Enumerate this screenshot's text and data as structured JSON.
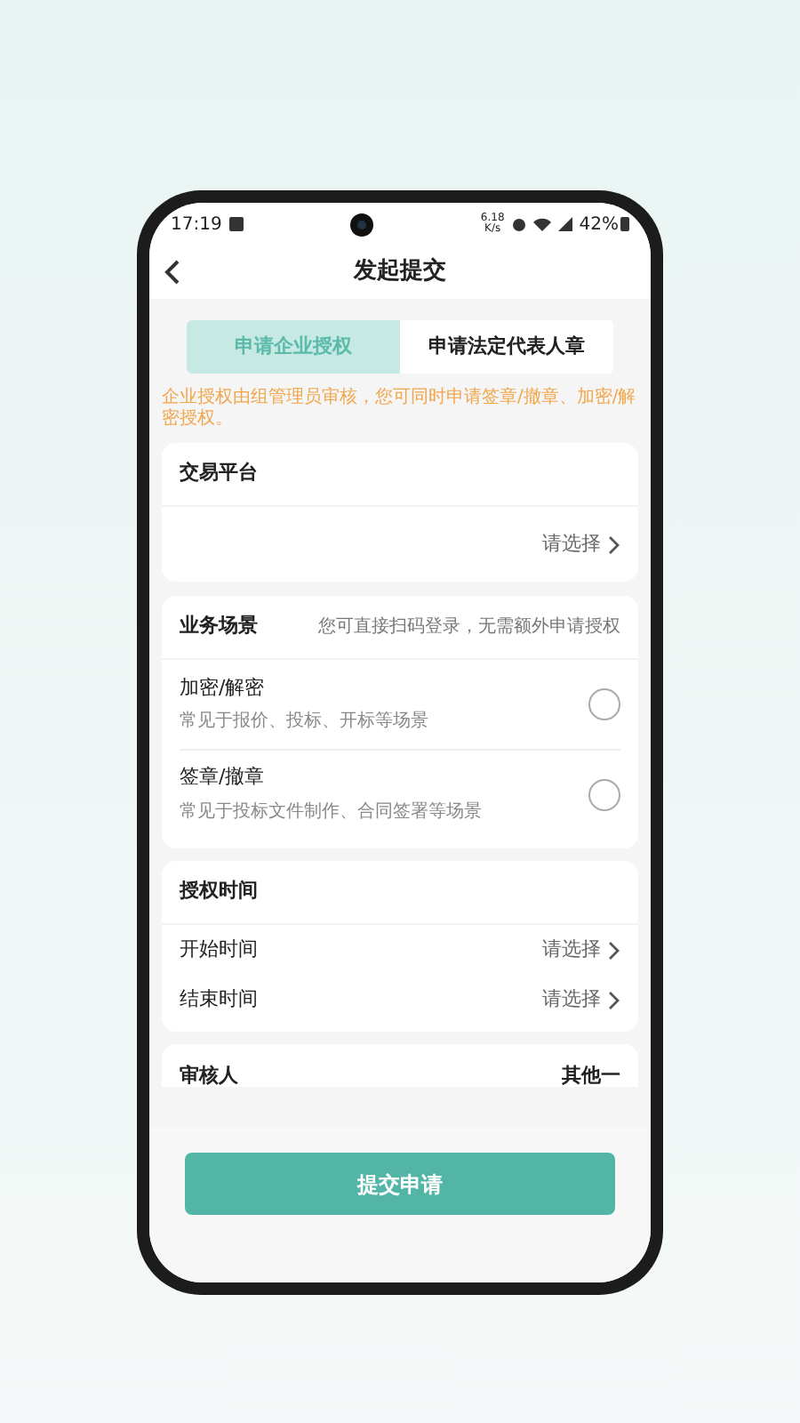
{
  "status_bar": {
    "time": "17:19",
    "speed": "6.18",
    "speed_unit": "K/s",
    "battery": "42%"
  },
  "header": {
    "title": "发起提交"
  },
  "tabs": [
    {
      "label": "申请企业授权",
      "selected": true
    },
    {
      "label": "申请法定代表人章",
      "selected": false
    }
  ],
  "notice": "企业授权由组管理员审核，您可同时申请签章/撤章、加密/解密授权。",
  "platform": {
    "title": "交易平台",
    "value": "请选择"
  },
  "scenario": {
    "title": "业务场景",
    "hint": "您可直接扫码登录，无需额外申请授权",
    "options": [
      {
        "label": "加密/解密",
        "description": "常见于报价、投标、开标等场景",
        "selected": false
      },
      {
        "label": "签章/撤章",
        "description": "常见于投标文件制作、合同签署等场景",
        "selected": false
      }
    ]
  },
  "period": {
    "title": "授权时间",
    "rows": [
      {
        "label": "开始时间",
        "value": "请选择"
      },
      {
        "label": "结束时间",
        "value": "请选择"
      }
    ]
  },
  "reviewer": {
    "label": "审核人",
    "value": "其他一"
  },
  "submit": "提交申请"
}
